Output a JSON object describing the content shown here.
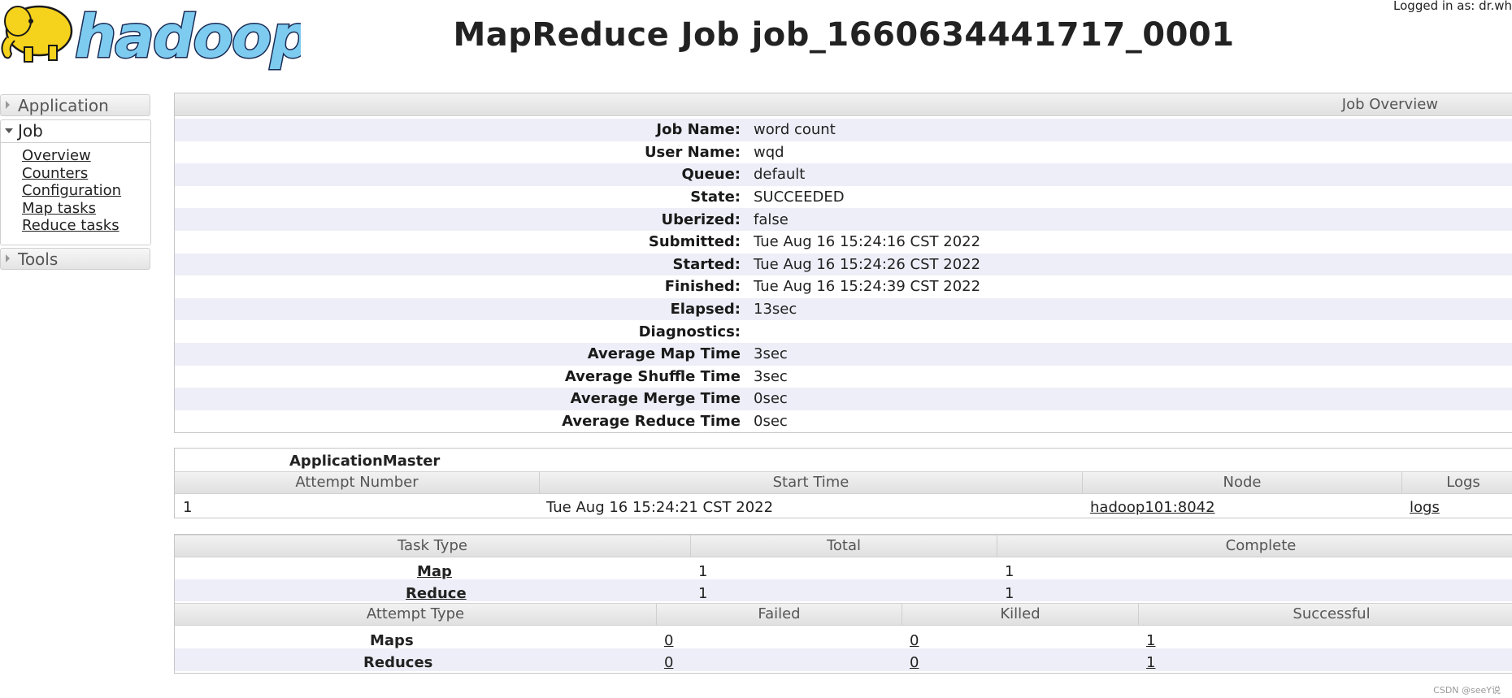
{
  "header": {
    "title": "MapReduce Job job_1660634441717_0001",
    "logged_in": "Logged in as: dr.wh"
  },
  "sidebar": {
    "application_label": "Application",
    "job_label": "Job",
    "job_links": [
      "Overview",
      "Counters",
      "Configuration",
      "Map tasks",
      "Reduce tasks"
    ],
    "tools_label": "Tools"
  },
  "job_overview": {
    "heading": "Job Overview",
    "rows": [
      {
        "key": "Job Name:",
        "value": "word count"
      },
      {
        "key": "User Name:",
        "value": "wqd"
      },
      {
        "key": "Queue:",
        "value": "default"
      },
      {
        "key": "State:",
        "value": "SUCCEEDED"
      },
      {
        "key": "Uberized:",
        "value": "false"
      },
      {
        "key": "Submitted:",
        "value": "Tue Aug 16 15:24:16 CST 2022"
      },
      {
        "key": "Started:",
        "value": "Tue Aug 16 15:24:26 CST 2022"
      },
      {
        "key": "Finished:",
        "value": "Tue Aug 16 15:24:39 CST 2022"
      },
      {
        "key": "Elapsed:",
        "value": "13sec"
      },
      {
        "key": "Diagnostics:",
        "value": ""
      },
      {
        "key": "Average Map Time",
        "value": "3sec"
      },
      {
        "key": "Average Shuffle Time",
        "value": "3sec"
      },
      {
        "key": "Average Merge Time",
        "value": "0sec"
      },
      {
        "key": "Average Reduce Time",
        "value": "0sec"
      }
    ]
  },
  "application_master": {
    "title": "ApplicationMaster",
    "columns": [
      "Attempt Number",
      "Start Time",
      "Node",
      "Logs"
    ],
    "row": {
      "attempt": "1",
      "start_time": "Tue Aug 16 15:24:21 CST 2022",
      "node": "hadoop101:8042",
      "logs": "logs"
    }
  },
  "tasks": {
    "columns": [
      "Task Type",
      "Total",
      "Complete"
    ],
    "rows": [
      {
        "type": "Map",
        "total": "1",
        "complete": "1"
      },
      {
        "type": "Reduce",
        "total": "1",
        "complete": "1"
      }
    ]
  },
  "attempts": {
    "columns": [
      "Attempt Type",
      "Failed",
      "Killed",
      "Successful"
    ],
    "rows": [
      {
        "type": "Maps",
        "failed": "0",
        "killed": "0",
        "successful": "1"
      },
      {
        "type": "Reduces",
        "failed": "0",
        "killed": "0",
        "successful": "1"
      }
    ]
  },
  "footer": {
    "watermark": "CSDN @seeY说"
  },
  "colors": {
    "row_alt": "#eeeef8",
    "logo_yellow": "#f5d21b",
    "logo_blue": "#7ecbf0"
  }
}
